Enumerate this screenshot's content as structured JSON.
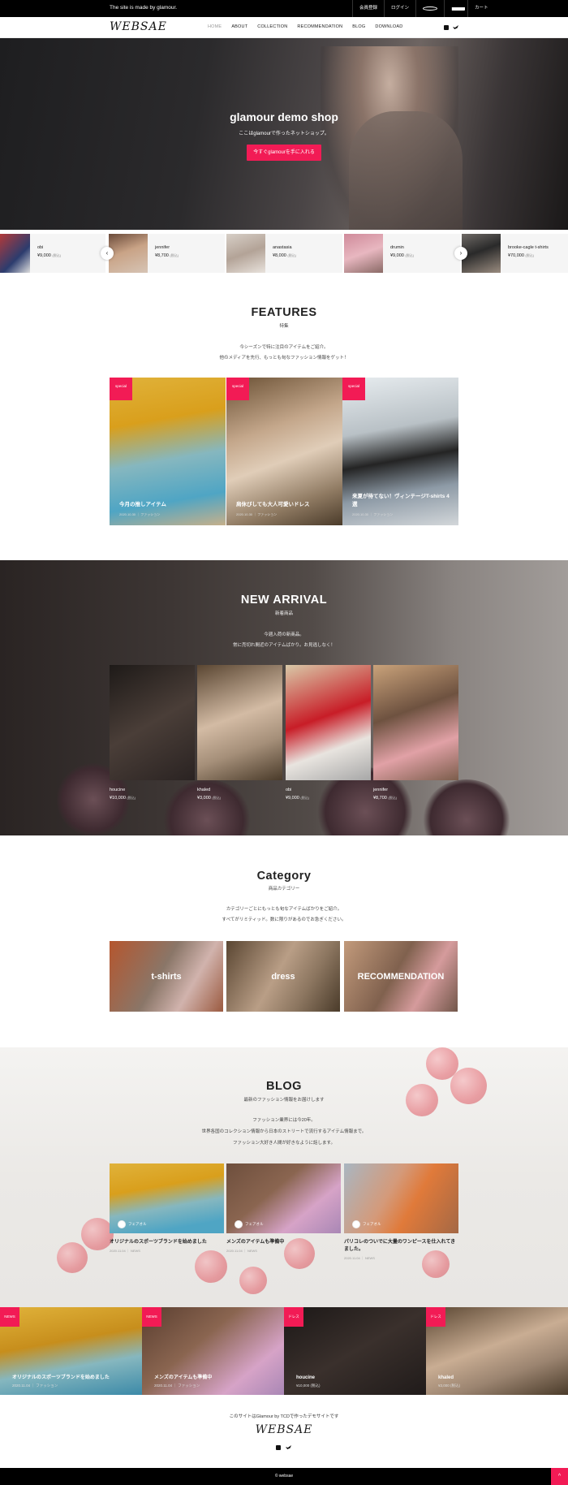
{
  "topbar": {
    "message": "The site is made by glamour.",
    "links": [
      "会員登録",
      "ログイン",
      "",
      "カート"
    ]
  },
  "header": {
    "logo": "WEBSAE",
    "nav": [
      "HOME",
      "ABOUT",
      "COLLECTION",
      "RECOMMENDATION",
      "BLOG",
      "DOWNLOAD"
    ]
  },
  "hero": {
    "title": "glamour demo shop",
    "subtitle": "ここはglamourで作ったネットショップ。",
    "button": "今すぐglamourを手に入れる"
  },
  "carousel": [
    {
      "name": "obi",
      "price": "¥9,000",
      "tax": "(税込)"
    },
    {
      "name": "jennifer",
      "price": "¥8,700",
      "tax": "(税込)"
    },
    {
      "name": "anastasia",
      "price": "¥8,000",
      "tax": "(税込)"
    },
    {
      "name": "drumin",
      "price": "¥9,000",
      "tax": "(税込)"
    },
    {
      "name": "brooke-cagle t-shirts",
      "price": "¥70,000",
      "tax": "(税込)"
    }
  ],
  "features": {
    "title": "FEATURES",
    "subtitle": "特集",
    "desc1": "今シーズンで特に注目のアイテムをご紹介。",
    "desc2": "他のメディアを先行、もっとも旬なファッション情報をゲット！",
    "cards": [
      {
        "badge": "special",
        "title": "今月の推しアイテム",
        "date": "2020.10.30 ｜ ファッション"
      },
      {
        "badge": "special",
        "title": "肩休びしても大人可愛いドレス",
        "date": "2020.10.30 ｜ ファッション"
      },
      {
        "badge": "special",
        "title": "来夏が待てない！ヴィンテージT-shirts 4選",
        "date": "2020.10.30 ｜ ファッション"
      }
    ]
  },
  "arrival": {
    "title": "NEW ARRIVAL",
    "subtitle": "新着商品",
    "desc1": "今週入荷の新商品。",
    "desc2": "常に売切れ間近のアイテムばかり。お見逃しなく！",
    "items": [
      {
        "name": "houcine",
        "price": "¥10,000",
        "tax": "(税込)"
      },
      {
        "name": "khaled",
        "price": "¥3,000",
        "tax": "(税込)"
      },
      {
        "name": "obi",
        "price": "¥9,000",
        "tax": "(税込)"
      },
      {
        "name": "jennifer",
        "price": "¥8,700",
        "tax": "(税込)"
      }
    ]
  },
  "category": {
    "title": "Category",
    "subtitle": "商品カテゴリー",
    "desc1": "カテゴリーごとにもっとも旬なアイテムばかりをご紹介。",
    "desc2": "すべてがリミティッド。数に限りがあるのでお急ぎください。",
    "items": [
      "t-shirts",
      "dress",
      "RECOMMENDATION"
    ]
  },
  "blog": {
    "title": "BLOG",
    "subtitle": "最新のファッション情報をお届けします",
    "desc1": "ファッション業界には今20年。",
    "desc2": "世界各国のコレクション情報から日本のストリートで流行するアイテム情報まで。",
    "desc3": "ファッション大好き人間が好きなように話します。",
    "posts": [
      {
        "author": "フェアオル",
        "title": "オリジナルのスポーツブランドを始めました",
        "date": "2020.11.04 ｜ NEWS"
      },
      {
        "author": "フェアオル",
        "title": "メンズのアイテムも準備中",
        "date": "2020.11.04 ｜ NEWS"
      },
      {
        "author": "フェアオル",
        "title": "パリコレのついでに大量のワンピースを仕入れてきました。",
        "date": "2020.11.04 ｜ NEWS"
      }
    ]
  },
  "news_row": [
    {
      "badge": "NEWS",
      "title": "オリジナルのスポーツブランドを始めました",
      "date": "2020.11.04 ｜ ファッション"
    },
    {
      "badge": "NEWS",
      "title": "メンズのアイテムも準備中",
      "date": "2020.11.04 ｜ ファッション"
    },
    {
      "badge": "ドレス",
      "title": "houcine",
      "date": "¥10,000 (税込)"
    },
    {
      "badge": "ドレス",
      "title": "khaled",
      "date": "¥3,000 (税込)"
    }
  ],
  "footer": {
    "desc": "このサイトはGlamour by TCDで作ったデモサイトです",
    "logo": "WEBSAE",
    "copyright": "© websae",
    "totop": "^"
  },
  "colors": {
    "accent": "#f21b55",
    "topbar": "#000000"
  }
}
